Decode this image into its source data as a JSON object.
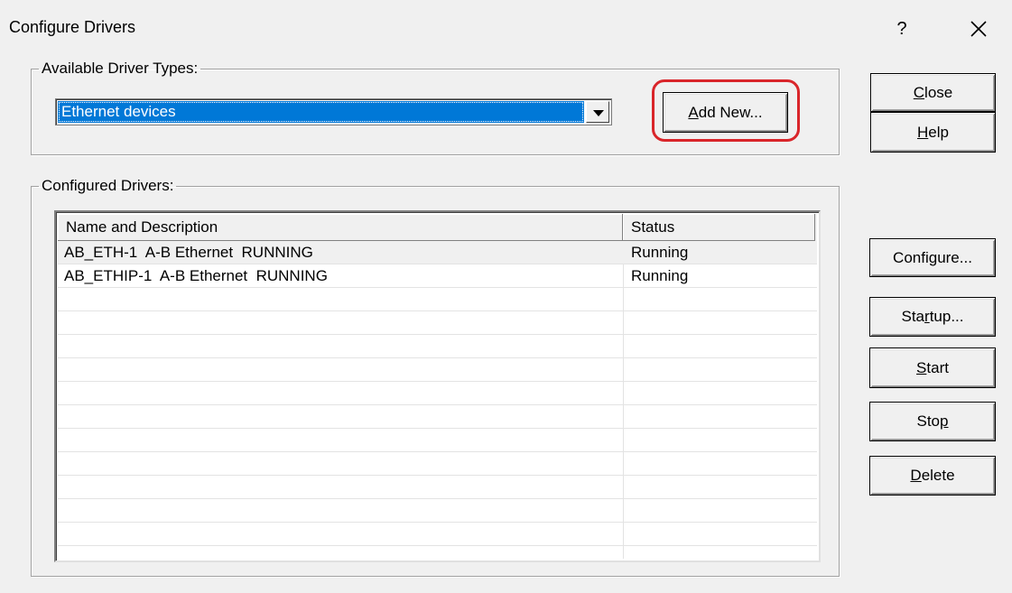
{
  "window": {
    "title": "Configure Drivers",
    "help_glyph": "?",
    "close_icon": "close-icon"
  },
  "available": {
    "legend": "Available Driver Types:",
    "selected": "Ethernet devices",
    "add_new_prefix": "",
    "add_new_accel": "A",
    "add_new_rest": "dd New...",
    "annotation_color": "#d9252a"
  },
  "configured": {
    "legend": "Configured Drivers:",
    "columns": [
      "Name and Description",
      "Status"
    ],
    "rows": [
      {
        "name": "AB_ETH-1  A-B Ethernet  RUNNING",
        "status": "Running"
      },
      {
        "name": "AB_ETHIP-1  A-B Ethernet  RUNNING",
        "status": "Running"
      }
    ]
  },
  "buttons": {
    "close": {
      "pre": "",
      "accel": "C",
      "post": "lose"
    },
    "help": {
      "pre": "",
      "accel": "H",
      "post": "elp"
    },
    "configure": {
      "pre": "Configure...",
      "accel": "",
      "post": ""
    },
    "startup": {
      "pre": "Sta",
      "accel": "r",
      "post": "tup..."
    },
    "start": {
      "pre": "",
      "accel": "S",
      "post": "tart"
    },
    "stop": {
      "pre": "Sto",
      "accel": "p",
      "post": ""
    },
    "delete": {
      "pre": "",
      "accel": "D",
      "post": "elete"
    }
  },
  "colors": {
    "selection": "#0078d7",
    "dialog_bg": "#f0f0f0"
  }
}
